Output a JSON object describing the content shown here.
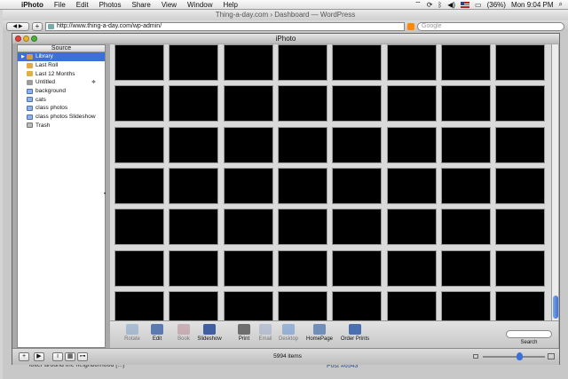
{
  "menubar": {
    "app": "iPhoto",
    "items": [
      "File",
      "Edit",
      "Photos",
      "Share",
      "View",
      "Window",
      "Help"
    ],
    "battery": "(36%)",
    "clock": "Mon 9:04 PM"
  },
  "browser": {
    "title": "Thing-a-day.com › Dashboard — WordPress",
    "url": "http://www.thing-a-day.com/wp-admin/",
    "search_placeholder": "Google",
    "back_label": "◀ ▶",
    "peek_text": "loiter around the neighborhood [...]",
    "peek_link": "Post #6543"
  },
  "iphoto": {
    "title": "iPhoto",
    "source_header": "Source",
    "source_items": [
      {
        "label": "Library",
        "icon": "library-icon",
        "selected": true
      },
      {
        "label": "Last Roll",
        "icon": "roll-icon"
      },
      {
        "label": "Last 12 Months",
        "icon": "calendar-icon"
      },
      {
        "label": "Untitled",
        "icon": "slideshow-icon"
      },
      {
        "label": "background",
        "icon": "album-icon"
      },
      {
        "label": "cats",
        "icon": "album-icon"
      },
      {
        "label": "class photos",
        "icon": "album-icon"
      },
      {
        "label": "class photos Slideshow",
        "icon": "album-icon"
      },
      {
        "label": "Trash",
        "icon": "trash-icon"
      }
    ],
    "tools": {
      "rotate": "Rotate",
      "edit": "Edit",
      "book": "Book",
      "slideshow": "Slideshow",
      "print": "Print",
      "email": "Email",
      "desktop": "Desktop",
      "homepage": "HomePage",
      "order_prints": "Order Prints"
    },
    "search_label": "Search",
    "item_count": "5994 items",
    "bottom_buttons": [
      "+",
      "▶",
      "i",
      "▦",
      "⊶"
    ],
    "grid": {
      "rows": 7,
      "cols": 8
    }
  },
  "colors": {
    "selection": "#3c70d8",
    "thumbnail": "#000000",
    "grid_bg": "#dadada"
  }
}
